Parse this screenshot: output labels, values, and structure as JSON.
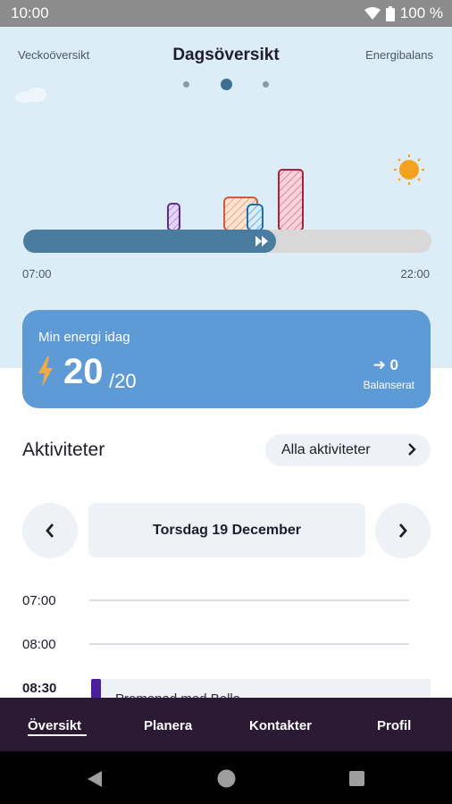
{
  "status_bar": {
    "time": "10:00",
    "battery": "100 %"
  },
  "header": {
    "nav_left": "Veckoöversikt",
    "title": "Dagsöversikt",
    "nav_right": "Energibalans",
    "pager": {
      "count": 3,
      "active": 2
    }
  },
  "timeline": {
    "start": "07:00",
    "end": "22:00",
    "progress_fraction": 0.62,
    "weather_icon": "sun-icon"
  },
  "energy": {
    "title": "Min energi idag",
    "value": "20",
    "max": "/20",
    "balance_value": "0",
    "balance_label": "Balanserat",
    "bolt_color": "#f0a848"
  },
  "activities": {
    "title": "Aktiviteter",
    "all_button": "Alla aktiviteter",
    "date": "Torsdag 19 December",
    "hours": [
      "07:00",
      "08:00",
      "08:30"
    ],
    "event_text": "Promenad med Bella"
  },
  "tabs": [
    "Översikt",
    "Planera",
    "Kontakter",
    "Profil"
  ],
  "colors": {
    "accent": "#5e9bd6",
    "progress": "#4a7c9f",
    "tabbar": "#2a1a33",
    "event_purple": "#4b1f9c"
  }
}
